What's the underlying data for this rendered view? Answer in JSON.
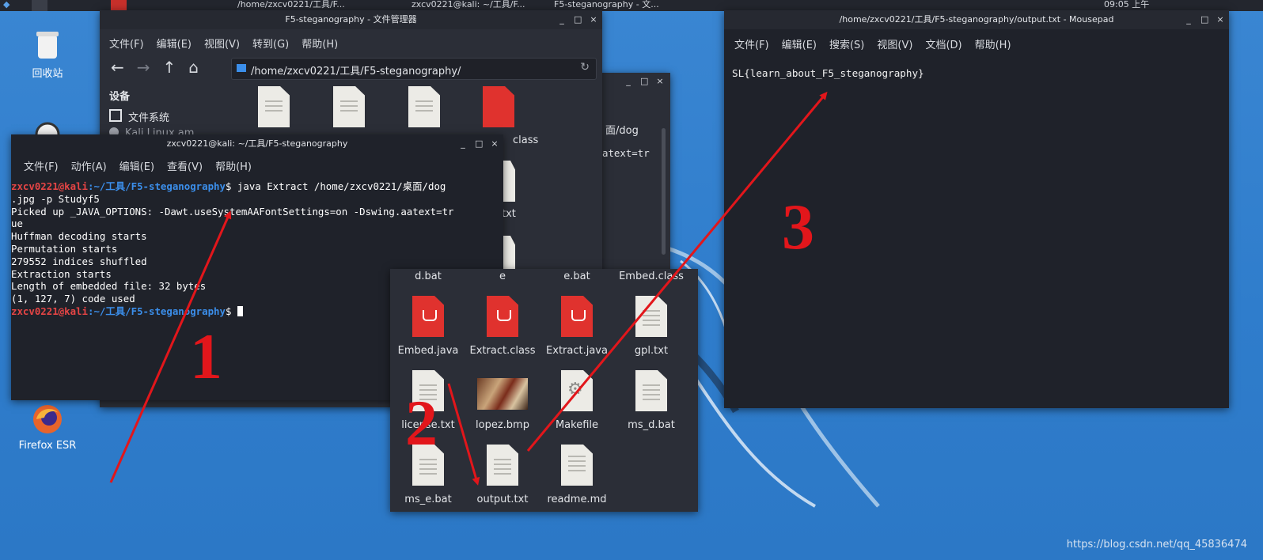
{
  "taskbar": {
    "left_title": "/home/zxcv0221/工具/F...",
    "mid_title": "zxcv0221@kali: ~/工具/F...",
    "right_title": "F5-steganography - 文...",
    "clock": "09:05 上午"
  },
  "desktop_icons": [
    {
      "label": "回收站"
    },
    {
      "label": "Firefox ESR"
    }
  ],
  "file_manager": {
    "title": "F5-steganography - 文件管理器",
    "menu": [
      "文件(F)",
      "编辑(E)",
      "视图(V)",
      "转到(G)",
      "帮助(H)"
    ],
    "path": "/home/zxcv0221/工具/F5-steganography/",
    "sidebar_header": "设备",
    "sidebar_items": [
      "文件系统",
      "Kali Linux am..."
    ]
  },
  "back_window": {
    "frag1": "面/dog",
    "frag2": "atext=tr",
    "frag3": "class",
    "frag4": "txt"
  },
  "terminal": {
    "title": "zxcv0221@kali: ~/工具/F5-steganography",
    "menu": [
      "文件(F)",
      "动作(A)",
      "编辑(E)",
      "查看(V)",
      "帮助(H)"
    ],
    "prompt_user": "zxcv0221@kali",
    "prompt_path": ":~/工具/F5-steganography",
    "prompt_sym": "$",
    "command": " java Extract /home/zxcv0221/桌面/dog",
    "lines": [
      ".jpg -p Studyf5",
      "Picked up _JAVA_OPTIONS: -Dawt.useSystemAAFontSettings=on -Dswing.aatext=tr",
      "ue",
      "Huffman decoding starts",
      "Permutation starts",
      "279552 indices shuffled",
      "Extraction starts",
      "Length of embedded file: 32 bytes",
      "(1, 127, 7) code used"
    ]
  },
  "icon_grid": {
    "files": [
      {
        "name": "d.bat",
        "type": "doc"
      },
      {
        "name": "e",
        "type": "doc"
      },
      {
        "name": "e.bat",
        "type": "doc"
      },
      {
        "name": "Embed.class",
        "type": "doc"
      },
      {
        "name": "Embed.java",
        "type": "java"
      },
      {
        "name": "Extract.class",
        "type": "java"
      },
      {
        "name": "Extract.java",
        "type": "java"
      },
      {
        "name": "gpl.txt",
        "type": "doc"
      },
      {
        "name": "license.txt",
        "type": "doc"
      },
      {
        "name": "lopez.bmp",
        "type": "image"
      },
      {
        "name": "Makefile",
        "type": "makefile"
      },
      {
        "name": "ms_d.bat",
        "type": "doc"
      },
      {
        "name": "ms_e.bat",
        "type": "doc"
      },
      {
        "name": "output.txt",
        "type": "doc"
      },
      {
        "name": "readme.md",
        "type": "markdown"
      }
    ]
  },
  "mousepad": {
    "title": "/home/zxcv0221/工具/F5-steganography/output.txt - Mousepad",
    "menu": [
      "文件(F)",
      "编辑(E)",
      "搜索(S)",
      "视图(V)",
      "文档(D)",
      "帮助(H)"
    ],
    "content": "SL{learn_about_F5_steganography}"
  },
  "annotations": {
    "one": "1",
    "two": "2",
    "three": "3"
  },
  "watermark": "https://blog.csdn.net/qq_45836474",
  "colors": {
    "annotation_red": "#e2161b",
    "desktop_blue": "#2f7fce",
    "window_bg": "#2b2e37",
    "prompt_red": "#e64545",
    "prompt_blue": "#3b8eea"
  }
}
